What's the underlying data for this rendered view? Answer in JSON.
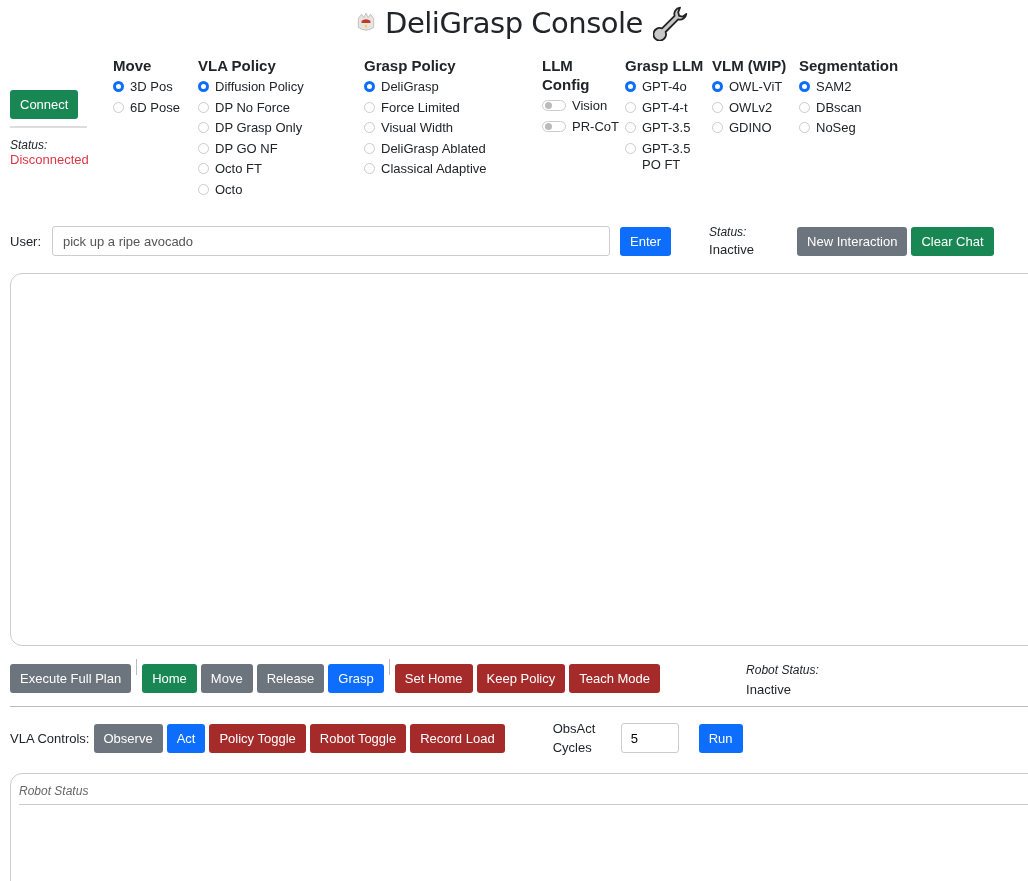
{
  "title": "DeliGrasp Console",
  "connect": {
    "label": "Connect",
    "status_label": "Status:",
    "status": "Disconnected",
    "connected": false
  },
  "groups": [
    {
      "kind": "radio",
      "heading": "Move",
      "options": [
        {
          "label": "3D Pos",
          "selected": true
        },
        {
          "label": "6D Pose",
          "selected": false
        }
      ]
    },
    {
      "kind": "radio",
      "heading": "VLA Policy",
      "options": [
        {
          "label": "Diffusion Policy",
          "selected": true
        },
        {
          "label": "DP No Force",
          "selected": false
        },
        {
          "label": "DP Grasp Only",
          "selected": false
        },
        {
          "label": "DP GO NF",
          "selected": false
        },
        {
          "label": "Octo FT",
          "selected": false
        },
        {
          "label": "Octo",
          "selected": false
        }
      ]
    },
    {
      "kind": "radio",
      "heading": "Grasp Policy",
      "options": [
        {
          "label": "DeliGrasp",
          "selected": true
        },
        {
          "label": "Force Limited",
          "selected": false
        },
        {
          "label": "Visual Width",
          "selected": false
        },
        {
          "label": "DeliGrasp Ablated",
          "selected": false
        },
        {
          "label": "Classical Adaptive",
          "selected": false
        }
      ]
    },
    {
      "kind": "switch",
      "heading": "LLM Config",
      "options": [
        {
          "label": "Vision",
          "checked": false
        },
        {
          "label": "PR-CoT",
          "checked": false
        }
      ]
    },
    {
      "kind": "radio",
      "heading": "Grasp LLM",
      "options": [
        {
          "label": "GPT-4o",
          "selected": true
        },
        {
          "label": "GPT-4-t",
          "selected": false
        },
        {
          "label": "GPT-3.5",
          "selected": false
        },
        {
          "label": "GPT-3.5 PO FT",
          "selected": false
        }
      ]
    },
    {
      "kind": "radio",
      "heading": "VLM (WIP)",
      "options": [
        {
          "label": "OWL-ViT",
          "selected": true
        },
        {
          "label": "OWLv2",
          "selected": false
        },
        {
          "label": "GDINO",
          "selected": false
        }
      ]
    },
    {
      "kind": "radio",
      "heading": "Segmentation",
      "options": [
        {
          "label": "SAM2",
          "selected": true
        },
        {
          "label": "DBscan",
          "selected": false
        },
        {
          "label": "NoSeg",
          "selected": false
        }
      ]
    }
  ],
  "user": {
    "label": "User:",
    "placeholder": "pick up a ripe avocado",
    "enter": "Enter",
    "status_label": "Status:",
    "status": "Inactive",
    "buttons": [
      {
        "label": "New Interaction",
        "color": "#6c757d"
      },
      {
        "label": "Clear Chat",
        "color": "#198754"
      }
    ]
  },
  "robot_buttons": [
    {
      "kind": "button",
      "label": "Execute Full Plan",
      "color": "#6c757d"
    },
    {
      "kind": "separator"
    },
    {
      "kind": "button",
      "label": "Home",
      "color": "#198754"
    },
    {
      "kind": "button",
      "label": "Move",
      "color": "#6c757d"
    },
    {
      "kind": "button",
      "label": "Release",
      "color": "#6c757d"
    },
    {
      "kind": "button",
      "label": "Grasp",
      "color": "#0d6efd"
    },
    {
      "kind": "separator"
    },
    {
      "kind": "button",
      "label": "Set Home",
      "color": "#a52a2a"
    },
    {
      "kind": "button",
      "label": "Keep Policy",
      "color": "#a52a2a"
    },
    {
      "kind": "button",
      "label": "Teach Mode",
      "color": "#a52a2a"
    }
  ],
  "robot_status": {
    "label": "Robot Status:",
    "value": "Inactive"
  },
  "vla": {
    "label": "VLA Controls:",
    "buttons": [
      {
        "label": "Observe",
        "color": "#6c757d"
      },
      {
        "label": "Act",
        "color": "#0d6efd"
      },
      {
        "label": "Policy Toggle",
        "color": "#a52a2a"
      },
      {
        "label": "Robot Toggle",
        "color": "#a52a2a"
      },
      {
        "label": "Record Load",
        "color": "#a52a2a"
      }
    ],
    "cycles_label": "ObsAct Cycles",
    "cycles": "5",
    "run": "Run"
  },
  "log": {
    "header": "Robot Status"
  }
}
